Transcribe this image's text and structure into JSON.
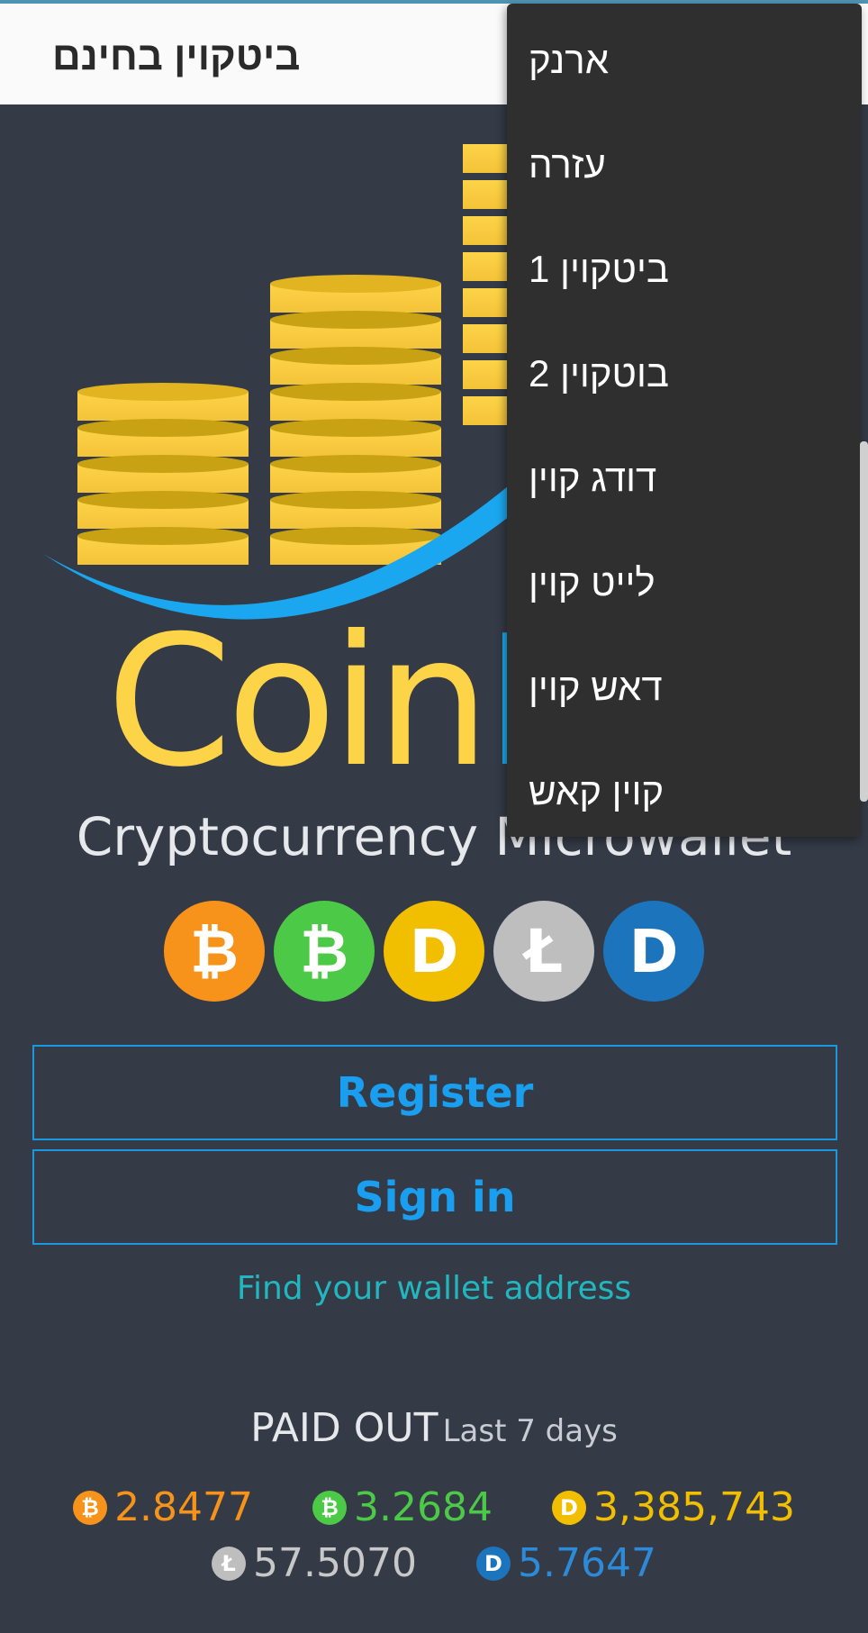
{
  "header": {
    "site_title": "ביטקוין בחינם"
  },
  "menu": {
    "items": [
      {
        "label": "ארנק"
      },
      {
        "label": "עזרה"
      },
      {
        "label": "ביטקוין 1"
      },
      {
        "label": "בוטקוין 2"
      },
      {
        "label": "דודג קוין"
      },
      {
        "label": "לייט קוין"
      },
      {
        "label": "דאש קוין"
      },
      {
        "label": "קוין קאש"
      }
    ]
  },
  "hero": {
    "brand_main": "Coin",
    "brand_accent": "P",
    "tagline": "Cryptocurrency Microwallet"
  },
  "coins": [
    {
      "icon": "bitcoin-icon",
      "glyph": "₿",
      "color": "#f7931a"
    },
    {
      "icon": "bitcoin-cash-icon",
      "glyph": "₿",
      "color": "#4cc947"
    },
    {
      "icon": "dogecoin-icon",
      "glyph": "D",
      "color": "#f2bf00"
    },
    {
      "icon": "litecoin-icon",
      "glyph": "Ł",
      "color": "#bebebe"
    },
    {
      "icon": "dash-icon",
      "glyph": "D",
      "color": "#1c75bc"
    }
  ],
  "buttons": {
    "register": "Register",
    "sign_in": "Sign in"
  },
  "links": {
    "find_wallet": "Find your wallet address"
  },
  "paid_out": {
    "title": "PAID OUT",
    "subtitle": "Last 7 days",
    "stats": [
      {
        "icon": "bitcoin-icon",
        "value": "2.8477",
        "color": "#f7931a"
      },
      {
        "icon": "bitcoin-cash-icon",
        "value": "3.2684",
        "color": "#4cc947"
      },
      {
        "icon": "dogecoin-icon",
        "value": "3,385,743",
        "color": "#f2bf00"
      },
      {
        "icon": "litecoin-icon",
        "value": "57.5070",
        "color": "#c8c8c8"
      },
      {
        "icon": "dash-icon",
        "value": "5.7647",
        "color": "#2d8ad8"
      }
    ]
  },
  "colors": {
    "background": "#343a46",
    "accent": "#1a9ff0",
    "brand_yellow": "#fdd348",
    "menu_bg": "#2f2f2f"
  }
}
